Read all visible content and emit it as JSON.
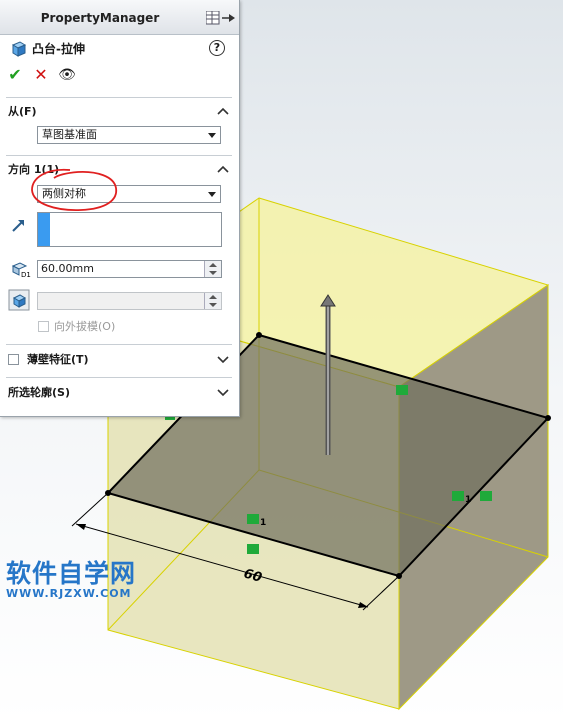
{
  "property_manager": {
    "title": "PropertyManager",
    "feature_name": "凸台-拉伸",
    "help_label": "?",
    "actions": {
      "ok_label": "✔",
      "cancel_label": "✕",
      "preview_label": "👁"
    }
  },
  "from_section": {
    "title": "从(F)",
    "start_condition": "草图基准面"
  },
  "direction1_section": {
    "title": "方向 1(1)",
    "end_condition": "两侧对称",
    "depth_value": "60.00mm",
    "draft_outward_label": "向外拔模(O)"
  },
  "thin_feature_section": {
    "title": "薄壁特征(T)"
  },
  "selected_contours_section": {
    "title": "所选轮廓(S)"
  },
  "model": {
    "dimension_value": "60",
    "relation_subscript": "1"
  },
  "watermark": {
    "main": "软件自学网",
    "sub": "WWW.RJZXW.COM"
  },
  "colors": {
    "accent": "#3a9bf0",
    "ok_green": "#22a022",
    "cancel_red": "#d01010",
    "annotation_red": "#e02020",
    "extrude_preview": "#f2f08a",
    "watermark_blue": "#2676c8"
  }
}
